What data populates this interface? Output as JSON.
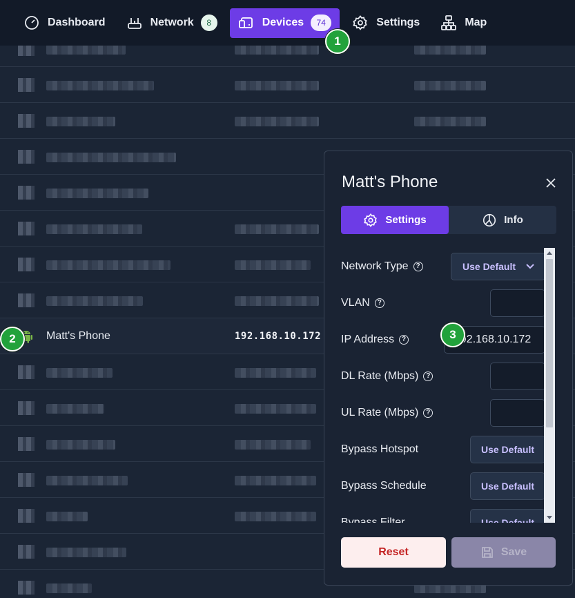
{
  "nav": {
    "items": [
      {
        "label": "Dashboard",
        "icon": "gauge-icon"
      },
      {
        "label": "Network",
        "icon": "router-icon",
        "badge": "8"
      },
      {
        "label": "Devices",
        "icon": "devices-icon",
        "badge": "74",
        "active": true
      },
      {
        "label": "Settings",
        "icon": "gear-icon"
      },
      {
        "label": "Map",
        "icon": "sitemap-icon"
      }
    ]
  },
  "table": {
    "selected_device": {
      "name": "Matt's Phone",
      "ip": "192.168.10.172",
      "icon": "android-icon"
    }
  },
  "markers": [
    "1",
    "2",
    "3"
  ],
  "panel": {
    "title": "Matt's Phone",
    "tabs": [
      {
        "label": "Settings",
        "icon": "gear-icon",
        "active": true
      },
      {
        "label": "Info",
        "icon": "info-chart-icon"
      }
    ],
    "help_glyph": "?",
    "fields": {
      "network_type": {
        "label": "Network Type",
        "value": "Use Default"
      },
      "vlan": {
        "label": "VLAN",
        "value": ""
      },
      "ip_address": {
        "label": "IP Address",
        "value": "192.168.10.172"
      },
      "dl_rate": {
        "label": "DL Rate (Mbps)",
        "value": ""
      },
      "ul_rate": {
        "label": "UL Rate (Mbps)",
        "value": ""
      },
      "bypass_hotspot": {
        "label": "Bypass Hotspot",
        "value": "Use Default"
      },
      "bypass_schedule": {
        "label": "Bypass Schedule",
        "value": "Use Default"
      },
      "bypass_filter": {
        "label": "Bypass Filter",
        "value": "Use Default"
      }
    },
    "reset_label": "Reset",
    "save_label": "Save"
  },
  "colors": {
    "accent": "#6d3ce6",
    "background": "#1b2535",
    "marker": "#22a23b",
    "reset_text": "#c42424"
  }
}
